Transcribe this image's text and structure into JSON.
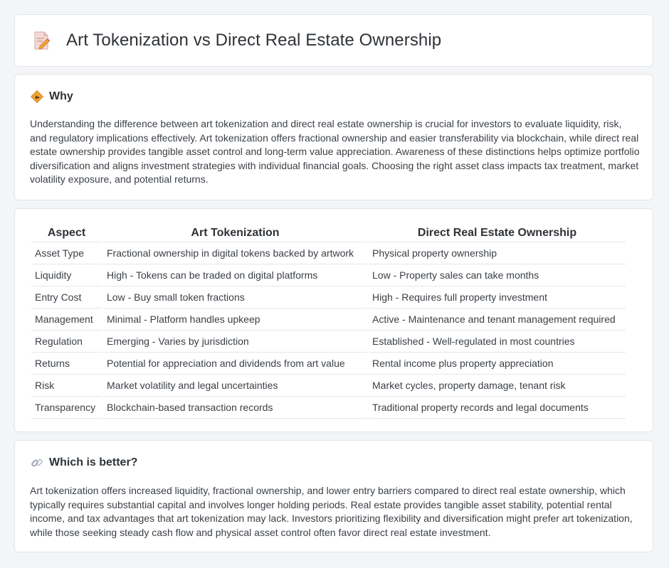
{
  "header": {
    "title": "Art Tokenization vs Direct Real Estate Ownership",
    "icon": "document-pencil-icon"
  },
  "why": {
    "title": "Why",
    "icon": "diamond-direction-icon",
    "body": "Understanding the difference between art tokenization and direct real estate ownership is crucial for investors to evaluate liquidity, risk, and regulatory implications effectively. Art tokenization offers fractional ownership and easier transferability via blockchain, while direct real estate ownership provides tangible asset control and long-term value appreciation. Awareness of these distinctions helps optimize portfolio diversification and aligns investment strategies with individual financial goals. Choosing the right asset class impacts tax treatment, market volatility exposure, and potential returns."
  },
  "table": {
    "headers": [
      "Aspect",
      "Art Tokenization",
      "Direct Real Estate Ownership"
    ],
    "rows": [
      [
        "Asset Type",
        "Fractional ownership in digital tokens backed by artwork",
        "Physical property ownership"
      ],
      [
        "Liquidity",
        "High - Tokens can be traded on digital platforms",
        "Low - Property sales can take months"
      ],
      [
        "Entry Cost",
        "Low - Buy small token fractions",
        "High - Requires full property investment"
      ],
      [
        "Management",
        "Minimal - Platform handles upkeep",
        "Active - Maintenance and tenant management required"
      ],
      [
        "Regulation",
        "Emerging - Varies by jurisdiction",
        "Established - Well-regulated in most countries"
      ],
      [
        "Returns",
        "Potential for appreciation and dividends from art value",
        "Rental income plus property appreciation"
      ],
      [
        "Risk",
        "Market volatility and legal uncertainties",
        "Market cycles, property damage, tenant risk"
      ],
      [
        "Transparency",
        "Blockchain-based transaction records",
        "Traditional property records and legal documents"
      ]
    ]
  },
  "better": {
    "title": "Which is better?",
    "icon": "link-icon",
    "body": "Art tokenization offers increased liquidity, fractional ownership, and lower entry barriers compared to direct real estate ownership, which typically requires substantial capital and involves longer holding periods. Real estate provides tangible asset stability, potential rental income, and tax advantages that art tokenization may lack. Investors prioritizing flexibility and diversification might prefer art tokenization, while those seeking steady cash flow and physical asset control often favor direct real estate investment."
  },
  "colors": {
    "background": "#f4f5f7",
    "card": "#ffffff",
    "border": "#e2e5e9",
    "text": "#3a3f45",
    "accent_orange": "#f0a030"
  }
}
